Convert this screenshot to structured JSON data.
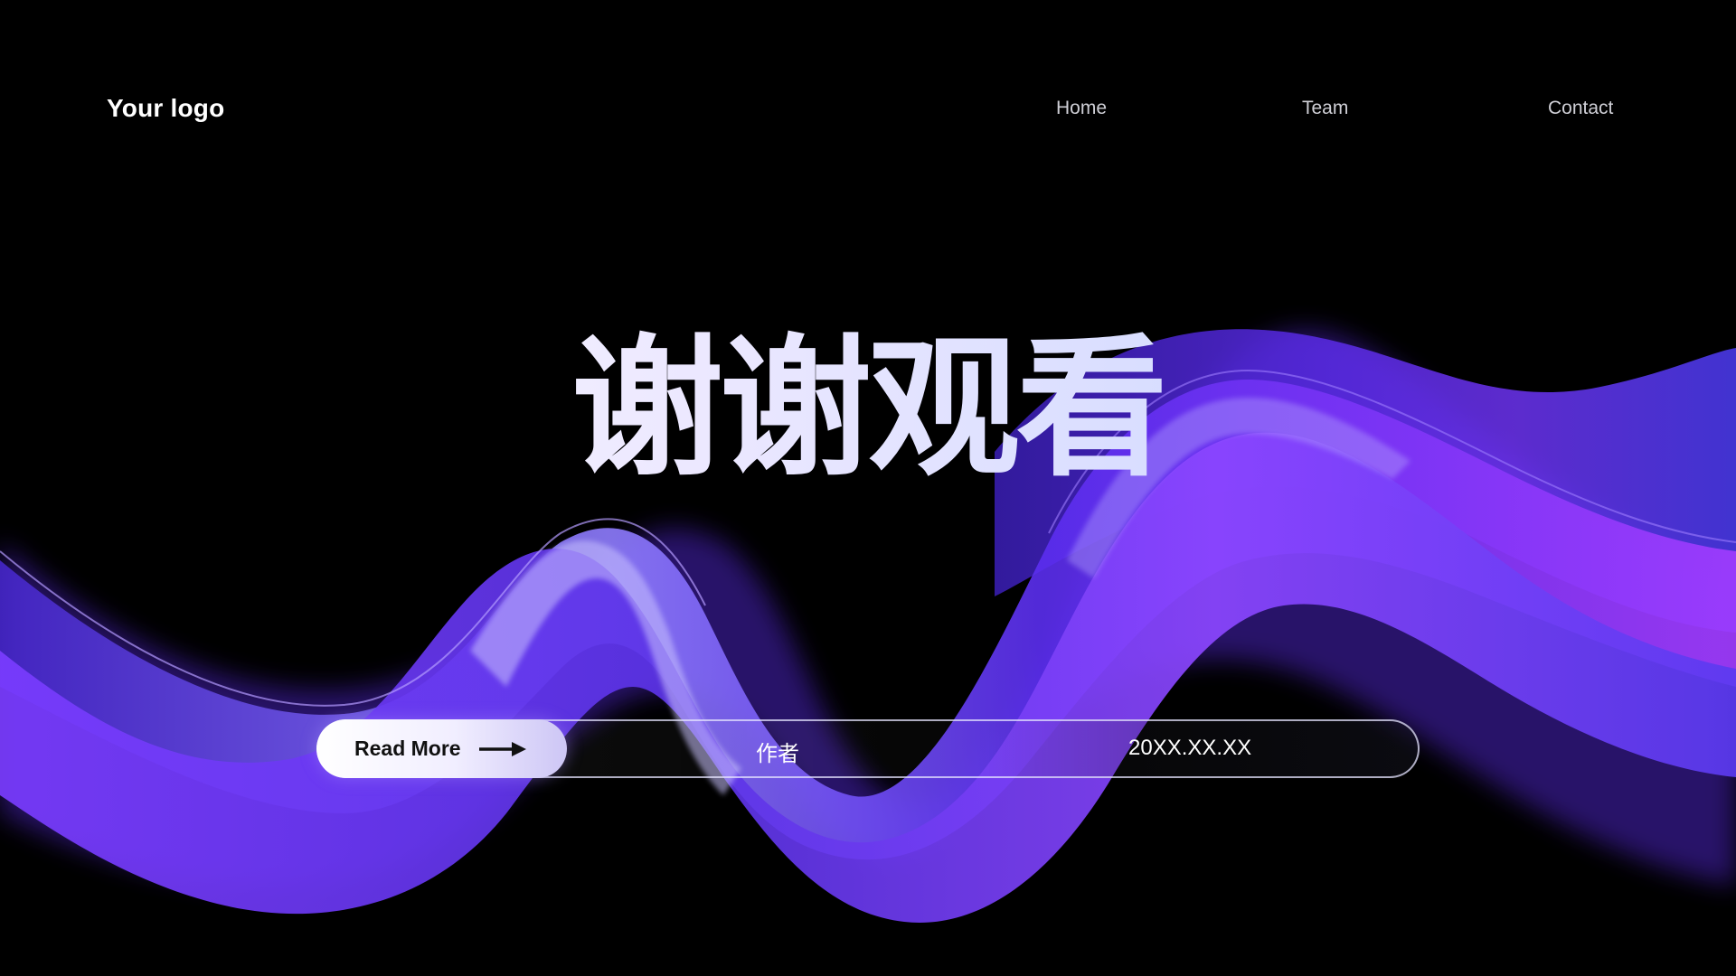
{
  "header": {
    "logo": "Your logo",
    "nav": [
      {
        "label": "Home"
      },
      {
        "label": "Team"
      },
      {
        "label": "Contact"
      }
    ]
  },
  "hero": {
    "title": "谢谢观看"
  },
  "info_bar": {
    "button_label": "Read More",
    "button_icon": "arrow-right-icon",
    "author": "作者",
    "date": "20XX.XX.XX"
  },
  "colors": {
    "background": "#000000",
    "wave_purple": "#6a2cf0",
    "wave_violet": "#9a3cff",
    "wave_blue": "#4a3cff"
  }
}
